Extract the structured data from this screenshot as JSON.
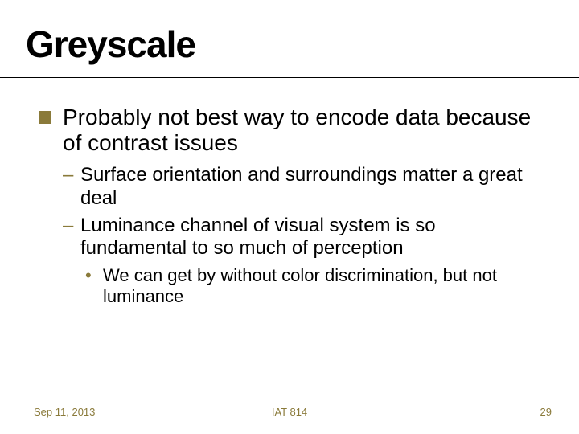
{
  "title": "Greyscale",
  "bullets": {
    "l1_0": "Probably not best way to encode data because of contrast issues",
    "l2_0": "Surface orientation and surroundings matter a great deal",
    "l2_1": "Luminance channel of visual system is so fundamental to so much of perception",
    "l3_0": "We can get by without color discrimination, but not luminance"
  },
  "footer": {
    "date": "Sep 11, 2013",
    "center": "IAT 814",
    "page": "29"
  }
}
